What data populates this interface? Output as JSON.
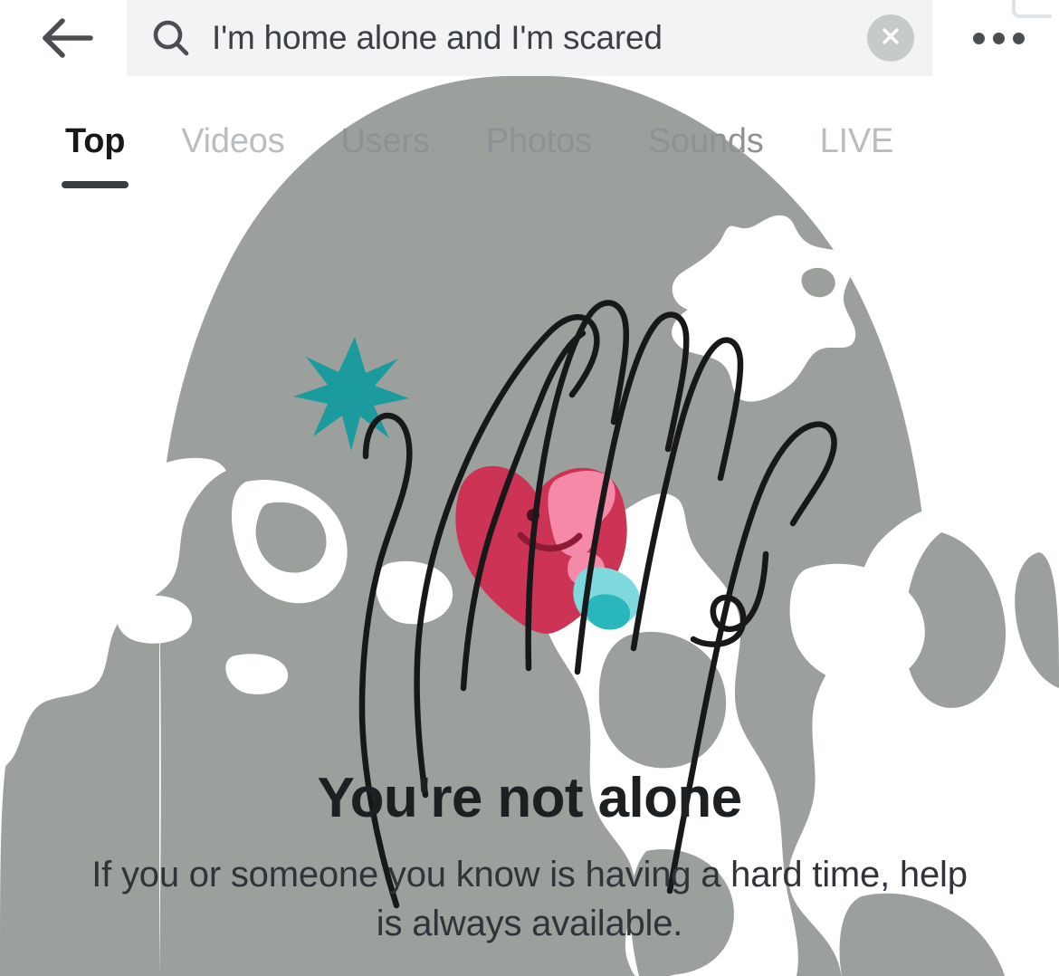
{
  "app": {
    "platform": "TikTok Search Results",
    "background_grey": "#9ba09c",
    "accent_teal": "#1b9b9e",
    "heart_red": "#cc3355",
    "heart_pink": "#f589a8"
  },
  "topbar": {
    "back_icon": "back-arrow-icon",
    "search_icon": "search-icon",
    "search_value": "I'm home alone and I'm scared",
    "search_placeholder": "Search",
    "clear_icon": "close-x-icon",
    "more_icon": "more-options-icon",
    "more_label": "•••"
  },
  "tabs": [
    {
      "label": "Top",
      "active": true,
      "style": "active"
    },
    {
      "label": "Videos",
      "active": false,
      "style": "faint"
    },
    {
      "label": "Users",
      "active": false,
      "style": "muted"
    },
    {
      "label": "Photos",
      "active": false,
      "style": "muted"
    },
    {
      "label": "Sounds",
      "active": false,
      "style": "muted"
    },
    {
      "label": "LIVE",
      "active": false,
      "style": "faint"
    }
  ],
  "content": {
    "illustration": "hands-holding-smiling-heart-illustration",
    "sparkle_icon": "sparkle-star-icon",
    "heading": "You're not alone",
    "body": "If you or someone you know is having a hard time, help is always available."
  }
}
